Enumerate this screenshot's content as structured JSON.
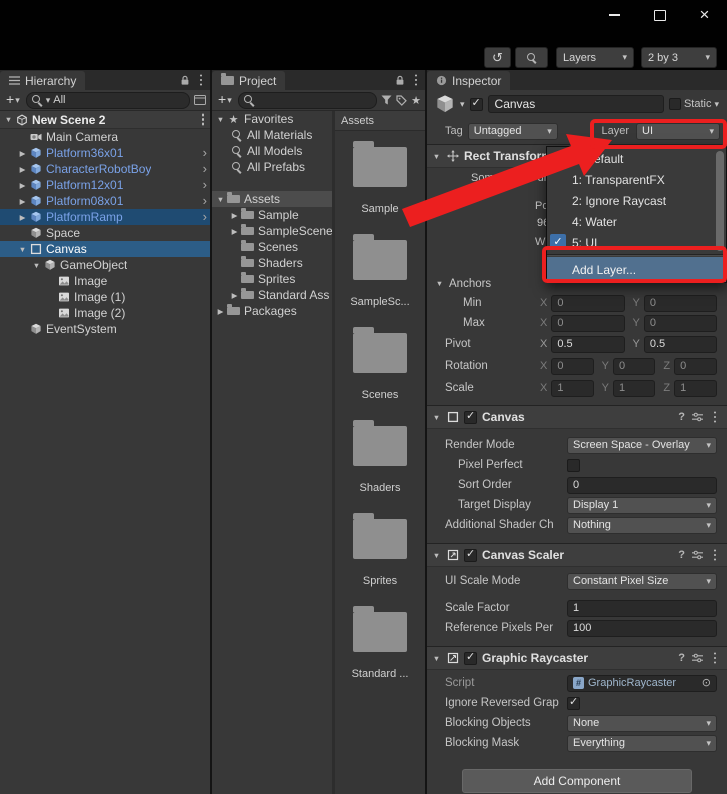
{
  "colors": {
    "selection_blue": "#2c5d87",
    "prefab_text_blue": "#7aa2e8",
    "annotation_red": "#ec1f1f",
    "popup_highlight": "#51708f"
  },
  "topbar": {
    "layers_label": "Layers",
    "layout_label": "2 by 3"
  },
  "hierarchy": {
    "tab": "Hierarchy",
    "search_value": "All",
    "scene_header": "New Scene 2",
    "items": [
      {
        "label": "Main Camera"
      },
      {
        "label": "Platform36x01"
      },
      {
        "label": "CharacterRobotBoy"
      },
      {
        "label": "Platform12x01"
      },
      {
        "label": "Platform08x01"
      },
      {
        "label": "PlatformRamp"
      },
      {
        "label": "Space"
      },
      {
        "label": "Canvas"
      },
      {
        "label": "GameObject"
      },
      {
        "label": "Image"
      },
      {
        "label": "Image (1)"
      },
      {
        "label": "Image (2)"
      },
      {
        "label": "EventSystem"
      }
    ]
  },
  "project": {
    "tab": "Project",
    "tree": [
      {
        "label": "Favorites"
      },
      {
        "label": "All Materials"
      },
      {
        "label": "All Models"
      },
      {
        "label": "All Prefabs"
      },
      {
        "label": "Assets"
      },
      {
        "label": "Sample"
      },
      {
        "label": "SampleScene"
      },
      {
        "label": "Scenes"
      },
      {
        "label": "Shaders"
      },
      {
        "label": "Sprites"
      },
      {
        "label": "Standard Ass"
      },
      {
        "label": "Packages"
      }
    ],
    "grid_header": "Assets",
    "grid": [
      {
        "label": "Sample"
      },
      {
        "label": "SampleSc..."
      },
      {
        "label": "Scenes"
      },
      {
        "label": "Shaders"
      },
      {
        "label": "Sprites"
      },
      {
        "label": "Standard ..."
      }
    ]
  },
  "inspector": {
    "tab": "Inspector",
    "header": {
      "name": "Canvas",
      "static_label": "Static",
      "tag_label": "Tag",
      "tag_value": "Untagged",
      "layer_label": "Layer",
      "layer_value": "UI"
    },
    "rect_transform": {
      "title": "Rect Transform",
      "driven_note": "Some values driven by Canvas.",
      "fragments": {
        "a": "Po",
        "b": "96",
        "c": "Wi"
      },
      "anchors_label": "Anchors",
      "vec_rows": [
        {
          "label": "Min",
          "fields": [
            {
              "axis": "X",
              "value": "0"
            },
            {
              "axis": "Y",
              "value": "0"
            }
          ]
        },
        {
          "label": "Max",
          "fields": [
            {
              "axis": "X",
              "value": "0"
            },
            {
              "axis": "Y",
              "value": "0"
            }
          ]
        },
        {
          "label": "Pivot",
          "fields": [
            {
              "axis": "X",
              "value": "0.5"
            },
            {
              "axis": "Y",
              "value": "0.5"
            }
          ]
        },
        {
          "label": "Rotation",
          "fields": [
            {
              "axis": "X",
              "value": "0"
            },
            {
              "axis": "Y",
              "value": "0"
            },
            {
              "axis": "Z",
              "value": "0"
            }
          ]
        },
        {
          "label": "Scale",
          "fields": [
            {
              "axis": "X",
              "value": "1"
            },
            {
              "axis": "Y",
              "value": "1"
            },
            {
              "axis": "Z",
              "value": "1"
            }
          ]
        }
      ]
    },
    "canvas": {
      "title": "Canvas",
      "render_mode_label": "Render Mode",
      "render_mode_value": "Screen Space - Overlay",
      "pixel_perfect_label": "Pixel Perfect",
      "sort_order_label": "Sort Order",
      "sort_order_value": "0",
      "target_display_label": "Target Display",
      "target_display_value": "Display 1",
      "additional_shader_label": "Additional Shader Ch",
      "additional_shader_value": "Nothing"
    },
    "canvas_scaler": {
      "title": "Canvas Scaler",
      "ui_scale_mode_label": "UI Scale Mode",
      "ui_scale_mode_value": "Constant Pixel Size",
      "scale_factor_label": "Scale Factor",
      "scale_factor_value": "1",
      "reference_label": "Reference Pixels Per",
      "reference_value": "100"
    },
    "graphic_raycaster": {
      "title": "Graphic Raycaster",
      "script_label": "Script",
      "script_value": "GraphicRaycaster",
      "ignore_label": "Ignore Reversed Grap",
      "blocking_objects_label": "Blocking Objects",
      "blocking_objects_value": "None",
      "blocking_mask_label": "Blocking Mask",
      "blocking_mask_value": "Everything"
    },
    "add_component_label": "Add Component"
  },
  "layer_popup": {
    "items": [
      {
        "label": "0: Default"
      },
      {
        "label": "1: TransparentFX"
      },
      {
        "label": "2: Ignore Raycast"
      },
      {
        "label": "4: Water"
      },
      {
        "label": "5: UI"
      }
    ],
    "add_label": "Add Layer..."
  }
}
